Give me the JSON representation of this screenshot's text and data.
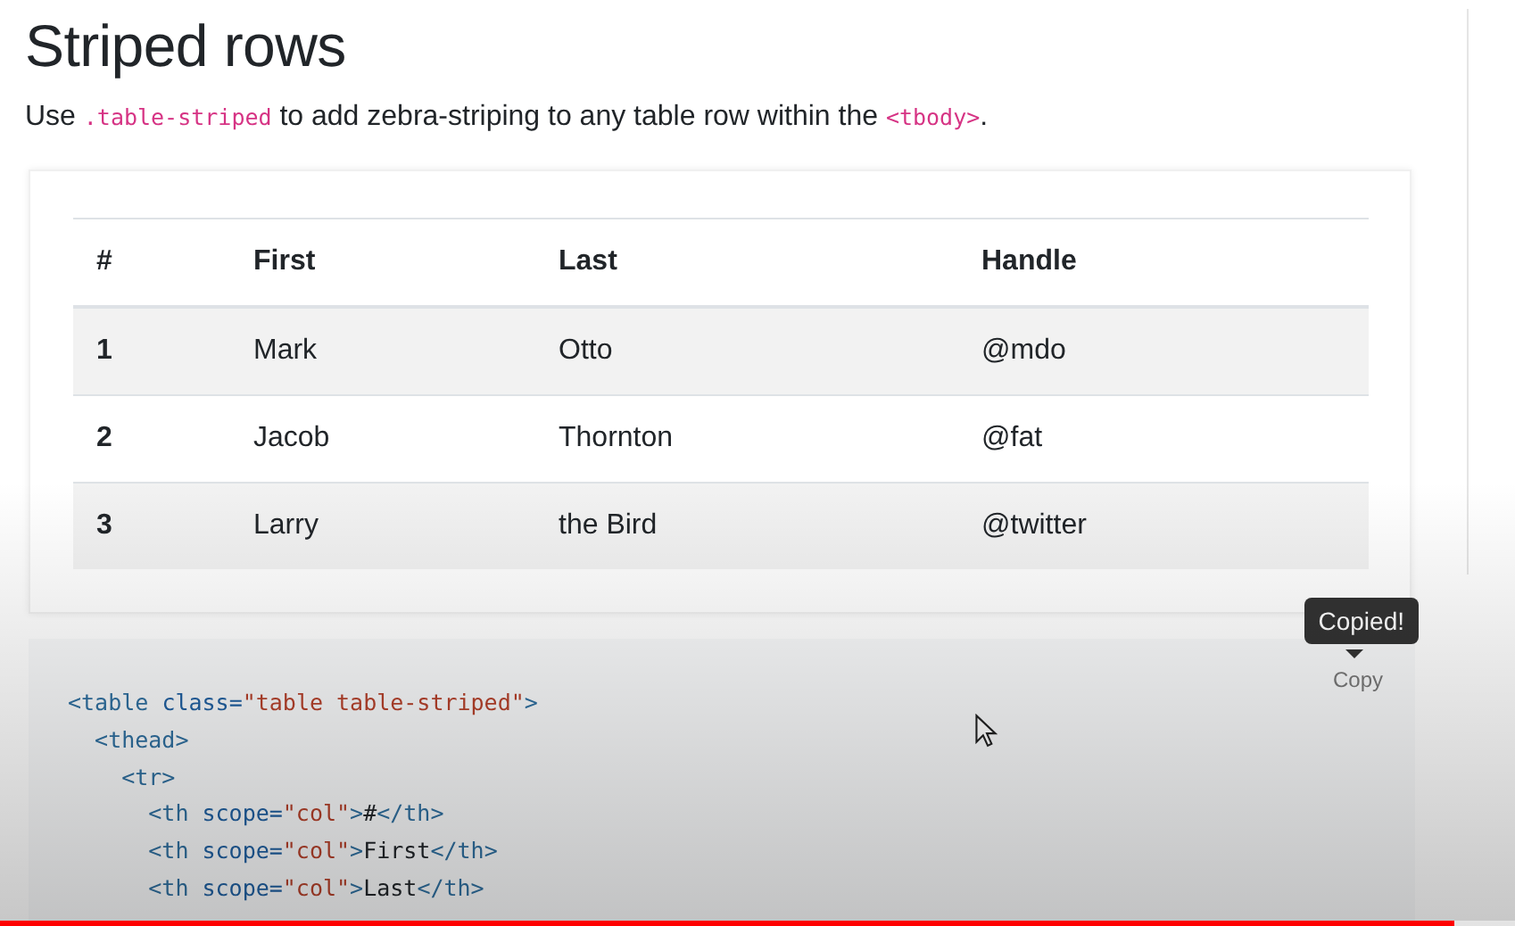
{
  "heading": "Striped rows",
  "intro": [
    {
      "kind": "text",
      "text": "Use "
    },
    {
      "kind": "code",
      "text": ".table-striped"
    },
    {
      "kind": "text",
      "text": " to add zebra-striping to any table row within the "
    },
    {
      "kind": "code",
      "text": "<tbody>"
    },
    {
      "kind": "text",
      "text": "."
    }
  ],
  "table": {
    "columns": [
      "#",
      "First",
      "Last",
      "Handle"
    ],
    "rows": [
      [
        "1",
        "Mark",
        "Otto",
        "@mdo"
      ],
      [
        "2",
        "Jacob",
        "Thornton",
        "@fat"
      ],
      [
        "3",
        "Larry",
        "the Bird",
        "@twitter"
      ]
    ]
  },
  "copy_button": {
    "label": "Copy"
  },
  "tooltip": {
    "text": "Copied!"
  },
  "code": [
    {
      "tokens": [
        {
          "kind": "tag",
          "text": "<table "
        },
        {
          "kind": "attr",
          "text": "class="
        },
        {
          "kind": "string",
          "text": "\"table table-striped\""
        },
        {
          "kind": "tag",
          "text": ">"
        }
      ],
      "children": [
        {
          "tokens": [
            {
              "kind": "tag",
              "text": "<thead>"
            }
          ],
          "children": [
            {
              "tokens": [
                {
                  "kind": "tag",
                  "text": "<tr>"
                }
              ],
              "children": [
                {
                  "tokens": [
                    {
                      "kind": "tag",
                      "text": "<th "
                    },
                    {
                      "kind": "attr",
                      "text": "scope="
                    },
                    {
                      "kind": "string",
                      "text": "\"col\""
                    },
                    {
                      "kind": "tag",
                      "text": ">"
                    },
                    {
                      "kind": "text",
                      "text": "#"
                    },
                    {
                      "kind": "tag",
                      "text": "</th>"
                    }
                  ]
                },
                {
                  "tokens": [
                    {
                      "kind": "tag",
                      "text": "<th "
                    },
                    {
                      "kind": "attr",
                      "text": "scope="
                    },
                    {
                      "kind": "string",
                      "text": "\"col\""
                    },
                    {
                      "kind": "tag",
                      "text": ">"
                    },
                    {
                      "kind": "text",
                      "text": "First"
                    },
                    {
                      "kind": "tag",
                      "text": "</th>"
                    }
                  ]
                },
                {
                  "tokens": [
                    {
                      "kind": "tag",
                      "text": "<th "
                    },
                    {
                      "kind": "attr",
                      "text": "scope="
                    },
                    {
                      "kind": "string",
                      "text": "\"col\""
                    },
                    {
                      "kind": "tag",
                      "text": ">"
                    },
                    {
                      "kind": "text",
                      "text": "Last"
                    },
                    {
                      "kind": "tag",
                      "text": "</th>"
                    }
                  ]
                }
              ]
            }
          ]
        }
      ]
    }
  ],
  "video_progress": {
    "level": 0.96
  }
}
